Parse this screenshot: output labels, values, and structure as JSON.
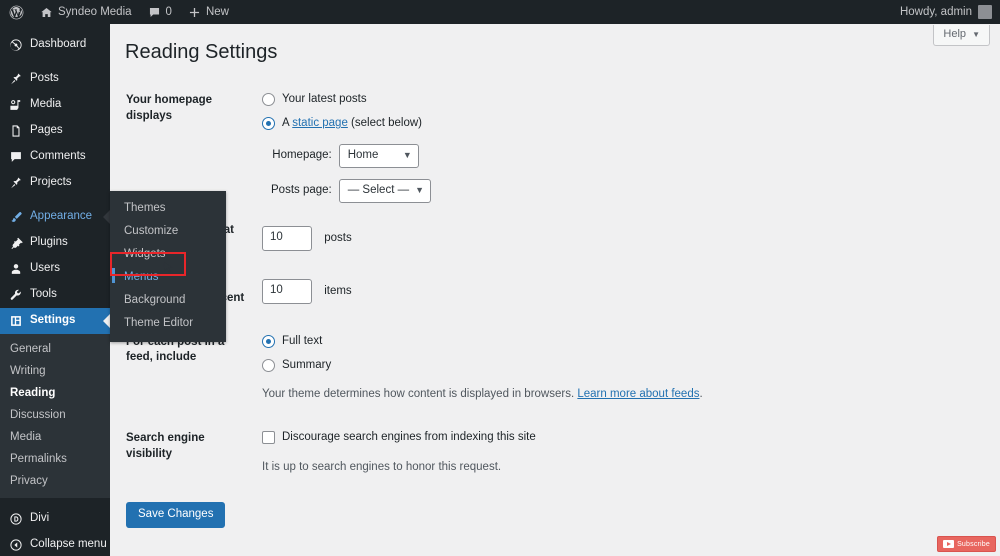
{
  "adminbar": {
    "logo_icon": "wordpress-logo-icon",
    "site_icon": "home-icon",
    "site_name": "Syndeo Media",
    "comments_icon": "comment-bubble-icon",
    "comments_count": "0",
    "new_icon": "plus-icon",
    "new_label": "New",
    "howdy": "Howdy, admin",
    "avatar": "user-avatar"
  },
  "sidebar": {
    "items": [
      {
        "label": "Dashboard",
        "icon": "dashboard-icon",
        "state": "default"
      },
      {
        "label": "Posts",
        "icon": "pin-icon",
        "state": "default"
      },
      {
        "label": "Media",
        "icon": "media-icon",
        "state": "default"
      },
      {
        "label": "Pages",
        "icon": "pages-icon",
        "state": "default"
      },
      {
        "label": "Comments",
        "icon": "comment-icon",
        "state": "default"
      },
      {
        "label": "Projects",
        "icon": "pin-icon",
        "state": "default"
      },
      {
        "label": "Appearance",
        "icon": "brush-icon",
        "state": "hovered"
      },
      {
        "label": "Plugins",
        "icon": "plug-icon",
        "state": "default"
      },
      {
        "label": "Users",
        "icon": "user-icon",
        "state": "default"
      },
      {
        "label": "Tools",
        "icon": "wrench-icon",
        "state": "default"
      },
      {
        "label": "Settings",
        "icon": "settings-gear-icon",
        "state": "current"
      }
    ],
    "settings_submenu": [
      {
        "label": "General",
        "active": false
      },
      {
        "label": "Writing",
        "active": false
      },
      {
        "label": "Reading",
        "active": true
      },
      {
        "label": "Discussion",
        "active": false
      },
      {
        "label": "Media",
        "active": false
      },
      {
        "label": "Permalinks",
        "active": false
      },
      {
        "label": "Privacy",
        "active": false
      }
    ],
    "bottom_items": [
      {
        "label": "Divi",
        "icon": "divi-icon"
      },
      {
        "label": "Collapse menu",
        "icon": "collapse-arrow-icon"
      }
    ]
  },
  "flyout": {
    "parent": "Appearance",
    "items": [
      {
        "label": "Themes",
        "hover": false
      },
      {
        "label": "Customize",
        "hover": false
      },
      {
        "label": "Widgets",
        "hover": false
      },
      {
        "label": "Menus",
        "hover": true
      },
      {
        "label": "Background",
        "hover": false
      },
      {
        "label": "Theme Editor",
        "hover": false
      }
    ],
    "highlight_color": "#e8262a",
    "highlight_target": "Menus"
  },
  "content": {
    "help_tab": "Help",
    "help_chevron": "▼",
    "page_title": "Reading Settings",
    "homepage_section": {
      "label": "Your homepage displays",
      "option_latest": "Your latest posts",
      "option_static_prefix": "A ",
      "option_static_link": "static page",
      "option_static_suffix": " (select below)",
      "selected": "static",
      "homepage_label": "Homepage:",
      "homepage_value": "Home",
      "posts_page_label": "Posts page:",
      "posts_page_value": "— Select —"
    },
    "blog_pages": {
      "label": "Blog pages show at most",
      "value": "10",
      "unit": "posts"
    },
    "syndication": {
      "label": "Syndication feeds show the most recent",
      "value": "10",
      "unit": "items"
    },
    "feed_section": {
      "label": "For each post in a feed, include",
      "option_full": "Full text",
      "option_summary": "Summary",
      "selected": "full",
      "description_prefix": "Your theme determines how content is displayed in browsers. ",
      "description_link": "Learn more about feeds",
      "description_suffix": "."
    },
    "search_visibility": {
      "label": "Search engine visibility",
      "checkbox_label": "Discourage search engines from indexing this site",
      "checked": false,
      "note": "It is up to search engines to honor this request."
    },
    "save_button": "Save Changes"
  },
  "overlay": {
    "subscribe_label": "Subscribe",
    "subscribe_icon": "youtube-play-icon"
  },
  "colors": {
    "admin_bar": "#1d2327",
    "sidebar": "#1d2327",
    "submenu": "#2c3338",
    "accent_blue": "#2271b1",
    "hover_blue": "#72aee6",
    "content_bg": "#f0f0f1",
    "highlight_red": "#e8262a"
  }
}
